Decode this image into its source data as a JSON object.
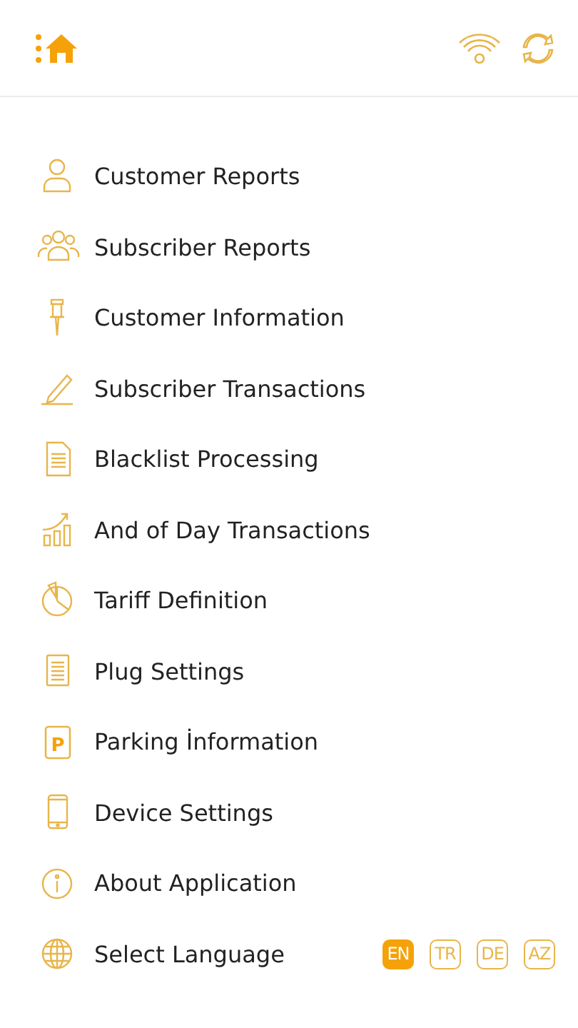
{
  "menu": [
    {
      "label": "Customer Reports"
    },
    {
      "label": "Subscriber Reports"
    },
    {
      "label": "Customer Information"
    },
    {
      "label": "Subscriber Transactions"
    },
    {
      "label": "Blacklist Processing"
    },
    {
      "label": "And of Day Transactions"
    },
    {
      "label": "Tariff Definition"
    },
    {
      "label": "Plug Settings"
    },
    {
      "label": "Parking İnformation",
      "icon_letter": "P"
    },
    {
      "label": "Device Settings"
    },
    {
      "label": "About Application"
    },
    {
      "label": "Select Language"
    }
  ],
  "languages": [
    {
      "code": "EN",
      "selected": true
    },
    {
      "code": "TR",
      "selected": false
    },
    {
      "code": "DE",
      "selected": false
    },
    {
      "code": "AZ",
      "selected": false
    }
  ]
}
